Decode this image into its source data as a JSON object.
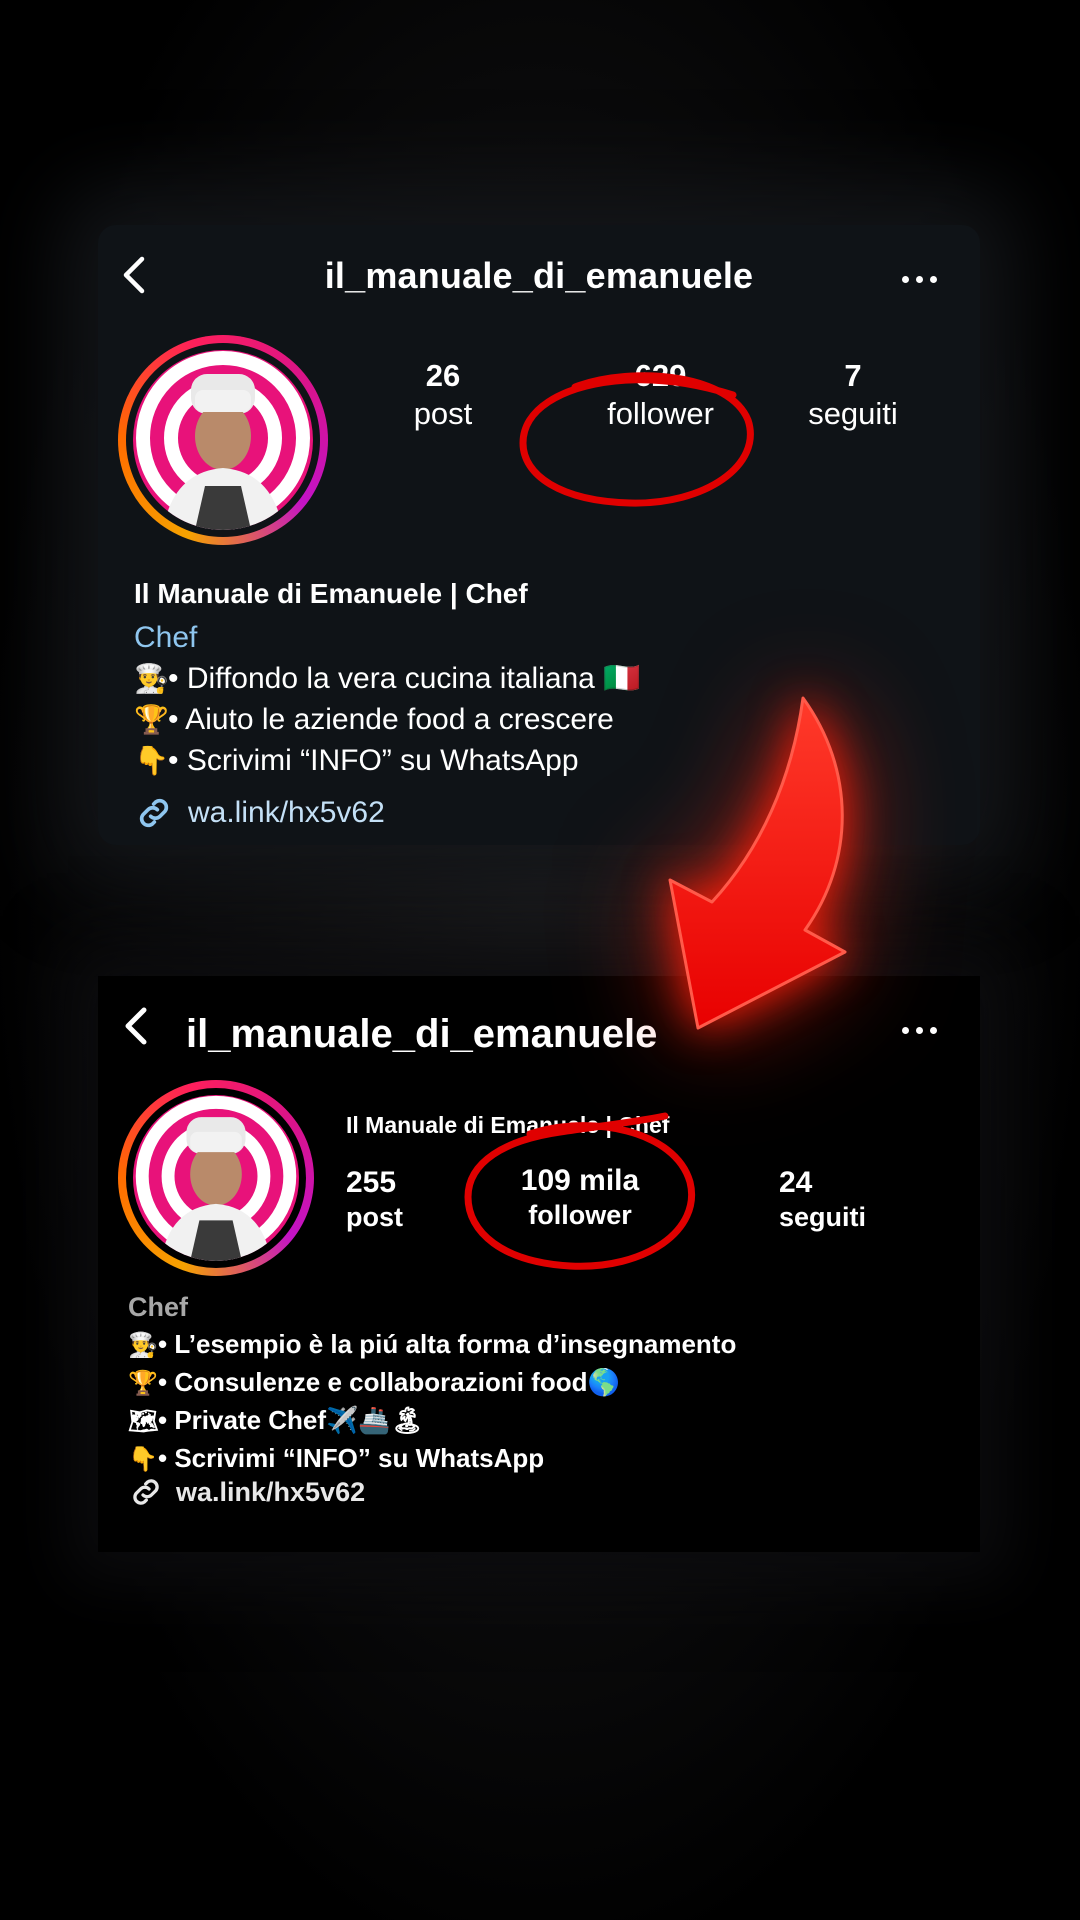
{
  "before": {
    "username": "il_manuale_di_emanuele",
    "stats": [
      {
        "value": "26",
        "label": "post"
      },
      {
        "value": "629",
        "label": "follower"
      },
      {
        "value": "7",
        "label": "seguiti"
      }
    ],
    "full_name": "Il Manuale di Emanuele | Chef",
    "category": "Chef",
    "bio": [
      {
        "icon": "chef-emoji-icon",
        "glyph": "👨‍🍳",
        "text": "• Diffondo la vera cucina italiana",
        "trailing": "🇮🇹"
      },
      {
        "icon": "trophy-emoji-icon",
        "glyph": "🏆",
        "text": "• Aiuto le aziende food a crescere",
        "trailing": ""
      },
      {
        "icon": "pointing-down-emoji-icon",
        "glyph": "👇",
        "text": "• Scrivimi “INFO” su WhatsApp",
        "trailing": ""
      }
    ],
    "link": "wa.link/hx5v62"
  },
  "after": {
    "username": "il_manuale_di_emanuele",
    "full_name": "Il Manuale di Emanuele | Chef",
    "stats": [
      {
        "value": "255",
        "label": "post"
      },
      {
        "value": "109 mila",
        "label": "follower"
      },
      {
        "value": "24",
        "label": "seguiti"
      }
    ],
    "category": "Chef",
    "bio": [
      {
        "icon": "chef-emoji-icon",
        "glyph": "👨‍🍳",
        "text": "• L’esempio è la piú alta forma d’insegnamento"
      },
      {
        "icon": "trophy-emoji-icon",
        "glyph": "🏆",
        "text": "• Consulenze e collaborazioni food🌎"
      },
      {
        "icon": "map-emoji-icon",
        "glyph": "🗺",
        "text": "• Private Chef✈️🚢🏝"
      },
      {
        "icon": "pointing-down-emoji-icon",
        "glyph": "👇",
        "text": "• Scrivimi “INFO” su WhatsApp"
      }
    ],
    "link": "wa.link/hx5v62"
  },
  "colors": {
    "accent_link": "#8fc6ef",
    "annotation_red": "#e00000",
    "story_ring": [
      "#f6a200",
      "#ff1f5b",
      "#c313c6"
    ]
  }
}
